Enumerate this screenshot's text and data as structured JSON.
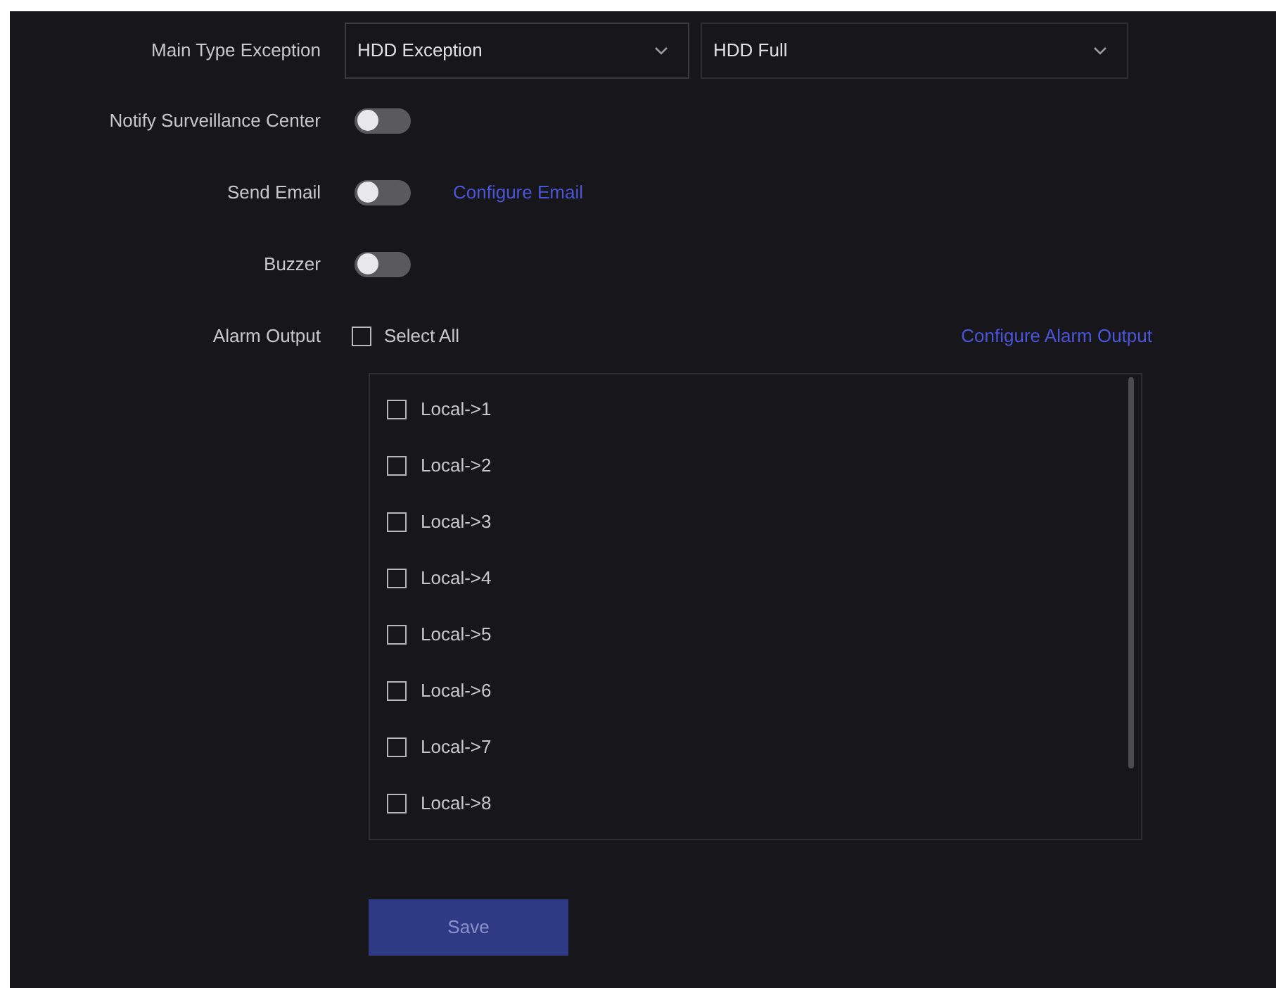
{
  "main_type": {
    "label": "Main Type Exception",
    "type_value": "HDD Exception",
    "subtype_value": "HDD Full"
  },
  "toggles": [
    {
      "label": "Notify Surveillance Center",
      "on": false
    },
    {
      "label": "Send Email",
      "on": false,
      "link": "Configure Email"
    },
    {
      "label": "Buzzer",
      "on": false
    }
  ],
  "alarm_output": {
    "label": "Alarm Output",
    "select_all": {
      "label": "Select All",
      "checked": false
    },
    "link": "Configure Alarm Output",
    "items": [
      {
        "label": "Local->1",
        "checked": false
      },
      {
        "label": "Local->2",
        "checked": false
      },
      {
        "label": "Local->3",
        "checked": false
      },
      {
        "label": "Local->4",
        "checked": false
      },
      {
        "label": "Local->5",
        "checked": false
      },
      {
        "label": "Local->6",
        "checked": false
      },
      {
        "label": "Local->7",
        "checked": false
      },
      {
        "label": "Local->8",
        "checked": false
      }
    ]
  },
  "buttons": [
    {
      "label": "Save"
    }
  ]
}
